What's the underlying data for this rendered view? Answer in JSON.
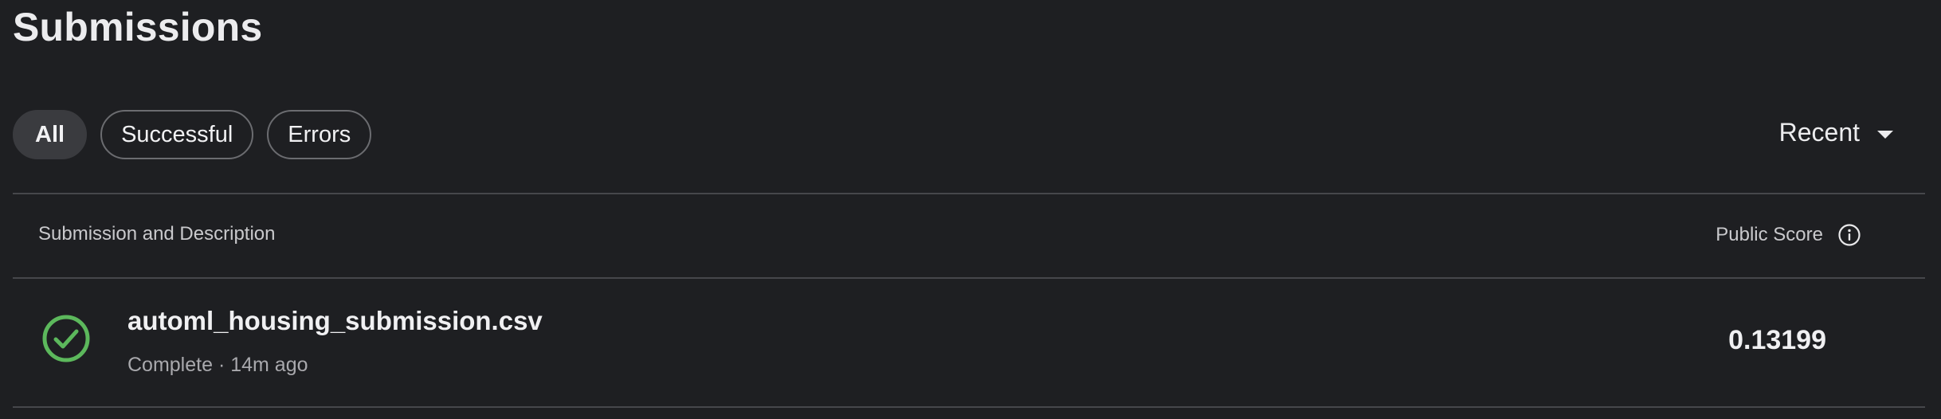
{
  "page": {
    "title": "Submissions"
  },
  "filters": [
    {
      "label": "All",
      "active": true
    },
    {
      "label": "Successful",
      "active": false
    },
    {
      "label": "Errors",
      "active": false
    }
  ],
  "sort": {
    "label": "Recent",
    "icon": "caret-down-icon"
  },
  "table": {
    "headers": {
      "description": "Submission and Description",
      "score": "Public Score",
      "score_info_icon": "info-icon"
    },
    "rows": [
      {
        "status_icon": "check-circle-icon",
        "status_color": "#5cb85c",
        "filename": "automl_housing_submission.csv",
        "meta": "Complete · 14m ago",
        "score": "0.13199"
      }
    ]
  },
  "colors": {
    "background": "#1e1f22",
    "divider": "#46474b",
    "chip_active_bg": "#3a3b3f",
    "success": "#5cb85c"
  }
}
